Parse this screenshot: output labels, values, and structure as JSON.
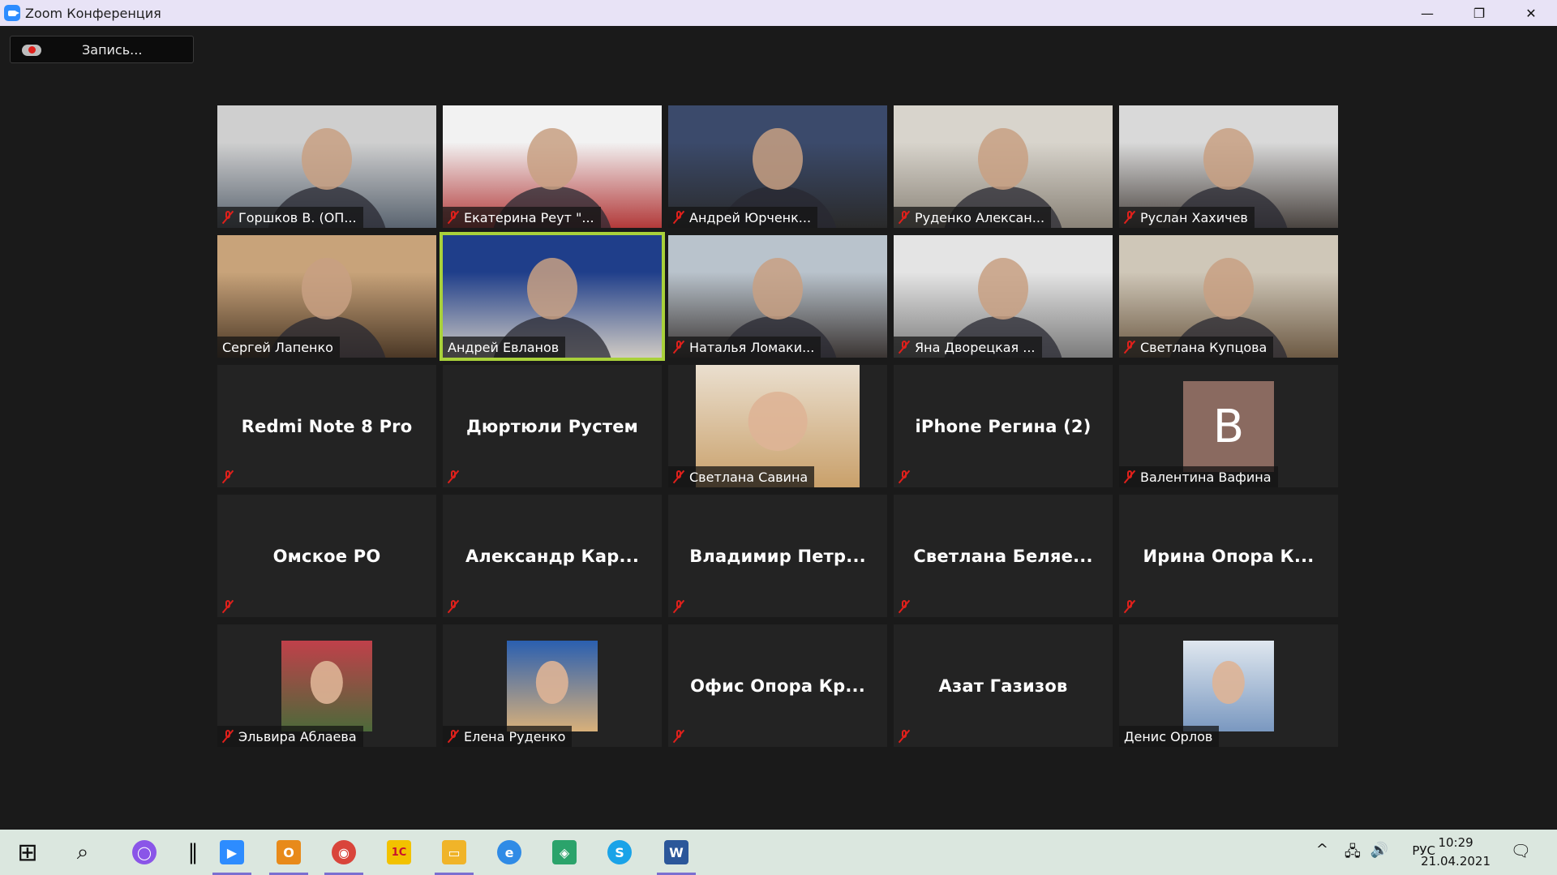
{
  "window": {
    "title": "Zoom Конференция",
    "controls": [
      "—",
      "❐",
      "✕"
    ]
  },
  "recording": {
    "label": "Запись..."
  },
  "participants": [
    {
      "name": "Горшков В. (ОП...",
      "muted": true,
      "mode": "video",
      "colors": [
        "#cfcfcf",
        "#5a6470"
      ]
    },
    {
      "name": "Екатерина Реут \"...",
      "muted": true,
      "mode": "video",
      "colors": [
        "#f2f2f2",
        "#b23a3a"
      ]
    },
    {
      "name": "Андрей Юрченк...",
      "muted": true,
      "mode": "video",
      "colors": [
        "#3b4a6b",
        "#2a2a2a"
      ]
    },
    {
      "name": "Руденко Алексан...",
      "muted": true,
      "mode": "video",
      "colors": [
        "#d8d4cc",
        "#8a8378"
      ]
    },
    {
      "name": "Руслан Хахичев",
      "muted": true,
      "mode": "video",
      "colors": [
        "#d9d9d9",
        "#4a4440"
      ]
    },
    {
      "name": "Сергей Лапенко",
      "muted": false,
      "mode": "video",
      "colors": [
        "#c8a37a",
        "#4b3826"
      ]
    },
    {
      "name": "Андрей Евланов",
      "muted": false,
      "mode": "video",
      "active": true,
      "colors": [
        "#1f3e8a",
        "#d0cbc4"
      ]
    },
    {
      "name": "Наталья Ломаки...",
      "muted": true,
      "mode": "video",
      "colors": [
        "#b9c3cc",
        "#3b3533"
      ]
    },
    {
      "name": "Яна Дворецкая ...",
      "muted": true,
      "mode": "video",
      "colors": [
        "#e4e4e4",
        "#7c7c7c"
      ]
    },
    {
      "name": "Светлана Купцова",
      "muted": true,
      "mode": "video",
      "colors": [
        "#cfc7b8",
        "#6d5a44"
      ]
    },
    {
      "name": "",
      "display": "Redmi Note 8 Pro",
      "muted": true,
      "mode": "name"
    },
    {
      "name": "",
      "display": "Дюртюли Рустем",
      "muted": true,
      "mode": "name"
    },
    {
      "name": "Светлана Савина",
      "muted": true,
      "mode": "photo-full",
      "colors": [
        "#eadfcf",
        "#c9a06a"
      ]
    },
    {
      "name": "",
      "display": "iPhone Регина (2)",
      "muted": true,
      "mode": "name"
    },
    {
      "name": "Валентина Вафина",
      "muted": true,
      "mode": "letter",
      "letter": "В"
    },
    {
      "name": "",
      "display": "Омское РО",
      "muted": true,
      "mode": "name"
    },
    {
      "name": "",
      "display": "Александр Кар...",
      "muted": true,
      "mode": "name"
    },
    {
      "name": "",
      "display": "Владимир Петр...",
      "muted": true,
      "mode": "name"
    },
    {
      "name": "",
      "display": "Светлана Беляе...",
      "muted": true,
      "mode": "name"
    },
    {
      "name": "",
      "display": "Ирина Опора К...",
      "muted": true,
      "mode": "name"
    },
    {
      "name": "Эльвира Аблаева",
      "muted": true,
      "mode": "photo",
      "colors": [
        "#c0404a",
        "#4c6a3a"
      ]
    },
    {
      "name": "Елена Руденко",
      "muted": true,
      "mode": "photo",
      "colors": [
        "#2a5fb0",
        "#d8b07a"
      ]
    },
    {
      "name": "",
      "display": "Офис Опора Кр...",
      "muted": true,
      "mode": "name"
    },
    {
      "name": "",
      "display": "Азат Газизов",
      "muted": true,
      "mode": "name"
    },
    {
      "name": "Денис Орлов",
      "muted": false,
      "mode": "photo",
      "colors": [
        "#dfe7ef",
        "#7a98c0"
      ]
    }
  ],
  "taskbar": {
    "apps": [
      {
        "name": "start",
        "glyph": "⊞",
        "color": "#111111"
      },
      {
        "name": "search",
        "glyph": "⌕",
        "color": "#111111"
      },
      {
        "name": "cortana",
        "glyph": "◯",
        "color": "#8a55e8"
      },
      {
        "name": "divider",
        "glyph": "‖",
        "color": "#111111"
      },
      {
        "name": "zoom",
        "glyph": "▶",
        "color": "#2d8cff"
      },
      {
        "name": "outlook",
        "glyph": "O",
        "color": "#e88a1a"
      },
      {
        "name": "chrome",
        "glyph": "◉",
        "color": "#d9453b"
      },
      {
        "name": "1c",
        "glyph": "1С",
        "color": "#f2c200"
      },
      {
        "name": "explorer",
        "glyph": "▭",
        "color": "#f0b429"
      },
      {
        "name": "ie",
        "glyph": "e",
        "color": "#2f8be6"
      },
      {
        "name": "monitor-app",
        "glyph": "◈",
        "color": "#2ba36b"
      },
      {
        "name": "skype",
        "glyph": "S",
        "color": "#1aa3e8"
      },
      {
        "name": "word",
        "glyph": "W",
        "color": "#2b579a"
      }
    ],
    "tray": {
      "chevron": "^",
      "network": "🖧",
      "volume": "🔊",
      "language": "РУС",
      "time": "10:29",
      "date": "21.04.2021",
      "notifications": "🗨"
    }
  }
}
